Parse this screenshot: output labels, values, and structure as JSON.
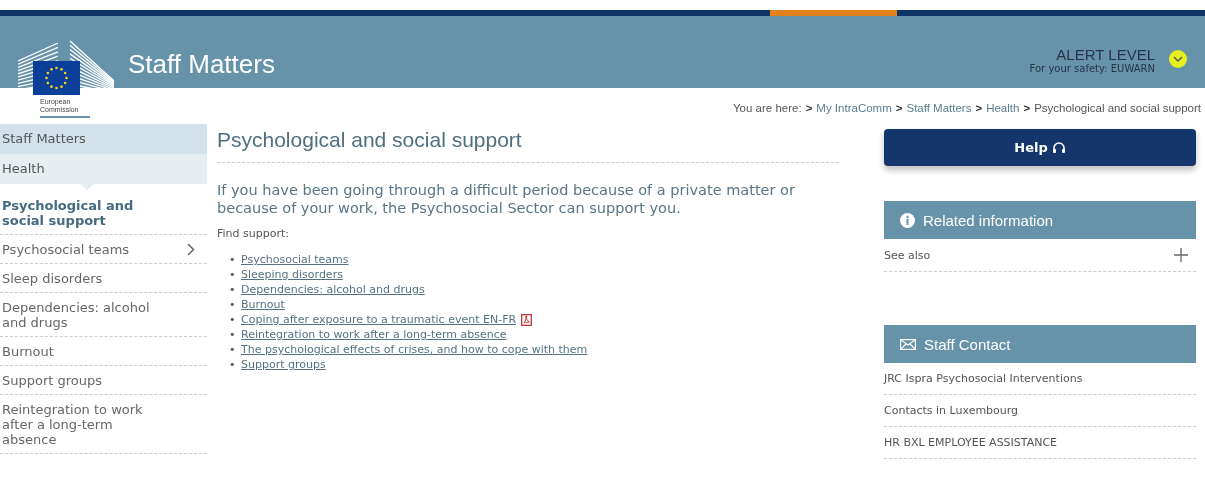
{
  "header": {
    "site_title": "Staff Matters",
    "logo_caption": "European Commission",
    "alert": {
      "title": "ALERT LEVEL",
      "subtitle": "For your safety: EUWARN",
      "color": "#e6f01e"
    }
  },
  "breadcrumb": {
    "label": "You are here:",
    "separator": ">",
    "items": [
      {
        "label": "My IntraComm",
        "link": true
      },
      {
        "label": "Staff Matters",
        "link": true
      },
      {
        "label": "Health",
        "link": true
      },
      {
        "label": "Psychological and social support",
        "link": false
      }
    ]
  },
  "sidebar": {
    "sections": [
      {
        "label": "Staff Matters",
        "kind": "section"
      },
      {
        "label": "Health",
        "kind": "subsection"
      }
    ],
    "items": [
      {
        "label": "Psychological and social support",
        "selected": true,
        "expandable": false
      },
      {
        "label": "Psychosocial teams",
        "selected": false,
        "expandable": true
      },
      {
        "label": "Sleep disorders",
        "selected": false,
        "expandable": false
      },
      {
        "label": "Dependencies: alcohol and drugs",
        "selected": false,
        "expandable": false
      },
      {
        "label": "Burnout",
        "selected": false,
        "expandable": false
      },
      {
        "label": "Support groups",
        "selected": false,
        "expandable": false
      },
      {
        "label": "Reintegration to work after a long-term absence",
        "selected": false,
        "expandable": false
      }
    ]
  },
  "main": {
    "title": "Psychological and social support",
    "intro": "If you have been going through a difficult period because of a private matter or because of your work, the Psychosocial Sector can support you.",
    "list_label": "Find support:",
    "bullet": "•",
    "links": [
      {
        "label": "Psychosocial teams",
        "pdf": false
      },
      {
        "label": "Sleeping disorders",
        "pdf": false
      },
      {
        "label": "Dependencies: alcohol and drugs",
        "pdf": false
      },
      {
        "label": "Burnout",
        "pdf": false
      },
      {
        "label": "Coping after exposure to a traumatic event EN-FR",
        "pdf": true
      },
      {
        "label": "Reintegration to work after a long-term absence",
        "pdf": false
      },
      {
        "label": "The psychological effects of crises, and how to cope with them",
        "pdf": false
      },
      {
        "label": "Support groups",
        "pdf": false
      }
    ]
  },
  "aside": {
    "help_button": "Help",
    "related": {
      "title": "Related information",
      "items": [
        {
          "label": "See also",
          "expandable": true
        }
      ]
    },
    "contact": {
      "title": "Staff Contact",
      "items": [
        "JRC Ispra Psychosocial Interventions",
        "Contacts in Luxembourg",
        "HR BXL EMPLOYEE ASSISTANCE"
      ]
    }
  }
}
